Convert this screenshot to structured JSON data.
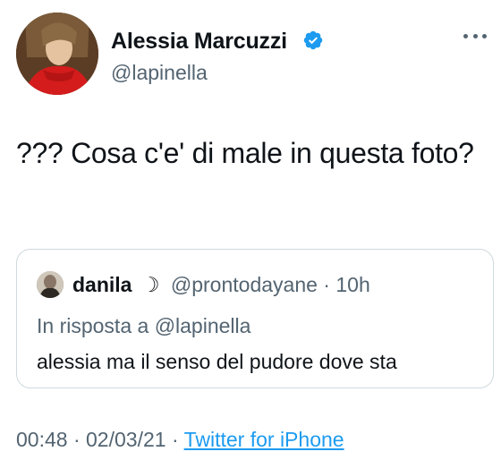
{
  "author": {
    "name": "Alessia Marcuzzi",
    "handle": "@lapinella",
    "verified_icon": "verified-badge-icon",
    "verified_color": "#1d9bf0"
  },
  "more_icon": "more-horizontal-icon",
  "tweet": {
    "text": "??? Cosa c'e' di male in questa foto?"
  },
  "quote": {
    "author_name": "danila",
    "moon": "☽",
    "handle": "@prontodayane",
    "separator": "·",
    "time": "10h",
    "reply_prefix": "In risposta a",
    "reply_mention": "@lapinella",
    "text": "alessia ma il senso del pudore dove sta"
  },
  "meta": {
    "time": "00:48",
    "dot1": "·",
    "date": "02/03/21",
    "dot2": "·",
    "source": "Twitter for iPhone"
  },
  "colors": {
    "text": "#0f1419",
    "secondary": "#536471",
    "link": "#1d9bf0",
    "border": "#cfd9de"
  }
}
